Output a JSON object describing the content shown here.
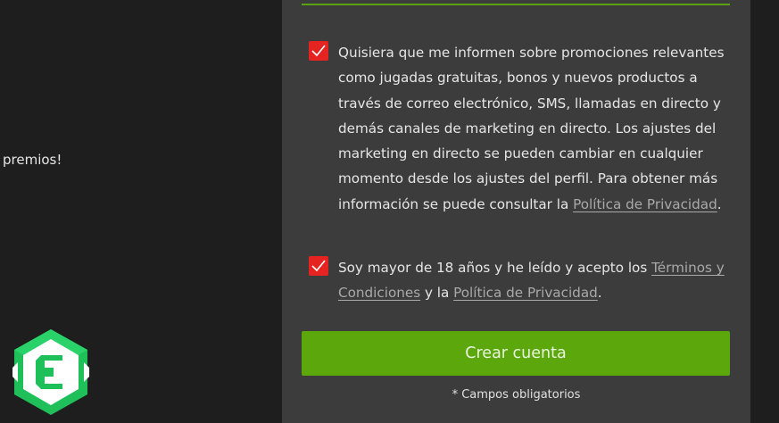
{
  "background": {
    "left_text": "premios!"
  },
  "form": {
    "consent_marketing": {
      "checked": true,
      "text": "Quisiera que me informen sobre promociones relevantes como jugadas gratuitas, bonos y nuevos productos a través de correo electrónico, SMS, llamadas en directo y demás canales de marketing en directo. Los ajustes del marketing  en directo se pueden cambiar en cualquier momento desde los ajustes del perfil. Para obtener más información se puede consultar la ",
      "link": "Política de Privacidad",
      "suffix": "."
    },
    "consent_terms": {
      "checked": true,
      "text_before": "Soy mayor de 18 años y he leído y acepto los ",
      "link_terms": "Términos y Condiciones",
      "text_middle": " y la ",
      "link_privacy": "Política de Privacidad",
      "suffix": "."
    },
    "submit_label": "Crear cuenta",
    "required_note": "* Campos obligatorios"
  },
  "colors": {
    "panel": "#3c3c3c",
    "accent_green": "#5ba70c",
    "checkbox_red": "#e52421",
    "background": "#1e1e1e"
  },
  "icons": {
    "checkbox_mark": "check-icon",
    "logo": "casino-logo-icon"
  }
}
